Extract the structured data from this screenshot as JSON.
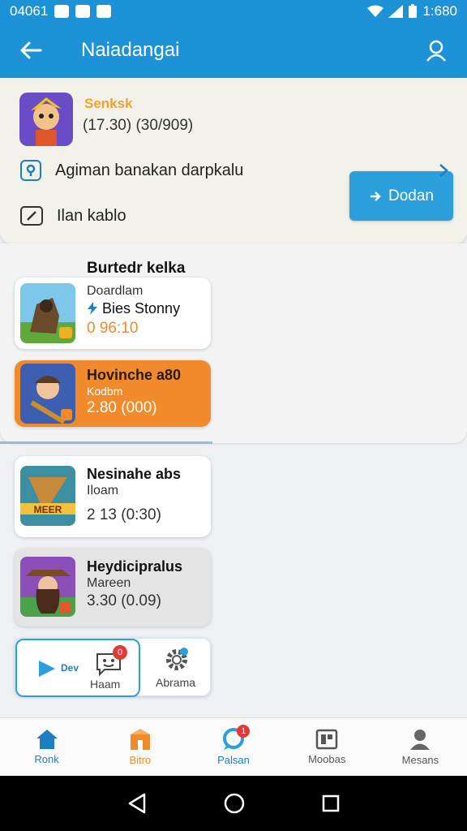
{
  "status": {
    "time_left": "04061",
    "time_right": "1:680"
  },
  "app_bar": {
    "title": "Naiadangai"
  },
  "top_card": {
    "name": "Senksk",
    "stats": "(17.30) (30/909)",
    "download_label": "Dodan",
    "option_1": "Agiman banakan darpkalu",
    "option_2": "Ilan kablo"
  },
  "section": {
    "title": "Burtedr kelka"
  },
  "games": [
    {
      "line1": "Doardlam",
      "line2": "Bies Stonny",
      "line3": "0 96:10"
    },
    {
      "line1": "Hovinche a80",
      "line2": "Kodbm",
      "line3": "2.80 (000)"
    },
    {
      "line1": "Nesinahe abs",
      "line2": "Iloam",
      "line3": "2 13 (0:30)"
    },
    {
      "line1": "Heydicipralus",
      "line2": "Mareen",
      "line3": "3.30 (0.09)"
    }
  ],
  "shortcuts": {
    "dev": "Dev",
    "badge": "0",
    "label_1": "Haam",
    "label_2": "Abrama"
  },
  "bottom_nav": {
    "items": [
      {
        "label": "Ronk"
      },
      {
        "label": "Bitro"
      },
      {
        "label": "Palsan",
        "badge": "1"
      },
      {
        "label": "Moobas"
      },
      {
        "label": "Mesans"
      }
    ]
  },
  "colors": {
    "primary": "#1e92d6",
    "accent_orange": "#f08a2a",
    "badge_red": "#e53935"
  }
}
